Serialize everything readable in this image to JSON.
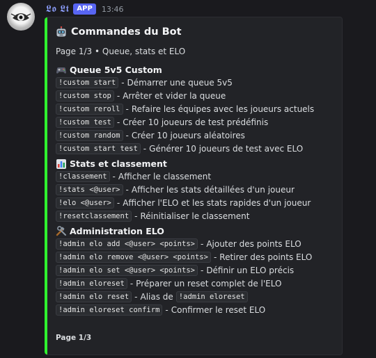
{
  "message": {
    "username": "𝕷𝖔 𝕷𝖙",
    "app_badge": "APP",
    "timestamp": "13:46"
  },
  "embed": {
    "accent_color": "#2ff22f",
    "title": "Commandes du Bot",
    "title_icon": "robot-icon",
    "subtitle": "Page 1/3 • Queue, stats et ELO",
    "sections": [
      {
        "icon": "gamepad-icon",
        "title": "Queue 5v5 Custom",
        "items": [
          {
            "command": "!custom start",
            "desc": "Démarrer une queue 5v5"
          },
          {
            "command": "!custom stop",
            "desc": "Arrêter et vider la queue"
          },
          {
            "command": "!custom reroll",
            "desc": "Refaire les équipes avec les joueurs actuels"
          },
          {
            "command": "!custom test",
            "desc": "Créer 10 joueurs de test prédéfinis"
          },
          {
            "command": "!custom random",
            "desc": "Créer 10 joueurs aléatoires"
          },
          {
            "command": "!custom start test",
            "desc": "Générer 10 joueurs de test avec ELO"
          }
        ]
      },
      {
        "icon": "bar-chart-icon",
        "title": "Stats et classement",
        "items": [
          {
            "command": "!classement",
            "desc": "Afficher le classement"
          },
          {
            "command": "!stats <@user>",
            "desc": "Afficher les stats détaillées d'un joueur"
          },
          {
            "command": "!elo <@user>",
            "desc": "Afficher l'ELO et les stats rapides d'un joueur"
          },
          {
            "command": "!resetclassement",
            "desc": "Réinitialiser le classement"
          }
        ]
      },
      {
        "icon": "tools-icon",
        "title": "Administration ELO",
        "items": [
          {
            "command": "!admin elo add <@user> <points>",
            "desc": "Ajouter des points ELO"
          },
          {
            "command": "!admin elo remove <@user> <points>",
            "desc": "Retirer des points ELO"
          },
          {
            "command": "!admin elo set <@user> <points>",
            "desc": "Définir un ELO précis"
          },
          {
            "command": "!admin eloreset",
            "desc": "Préparer un reset complet de l'ELO"
          },
          {
            "command": "!admin elo reset",
            "desc": "Alias de",
            "desc_code": "!admin eloreset"
          },
          {
            "command": "!admin eloreset confirm",
            "desc": "Confirmer le reset ELO"
          }
        ]
      }
    ],
    "footer": "Page 1/3"
  }
}
